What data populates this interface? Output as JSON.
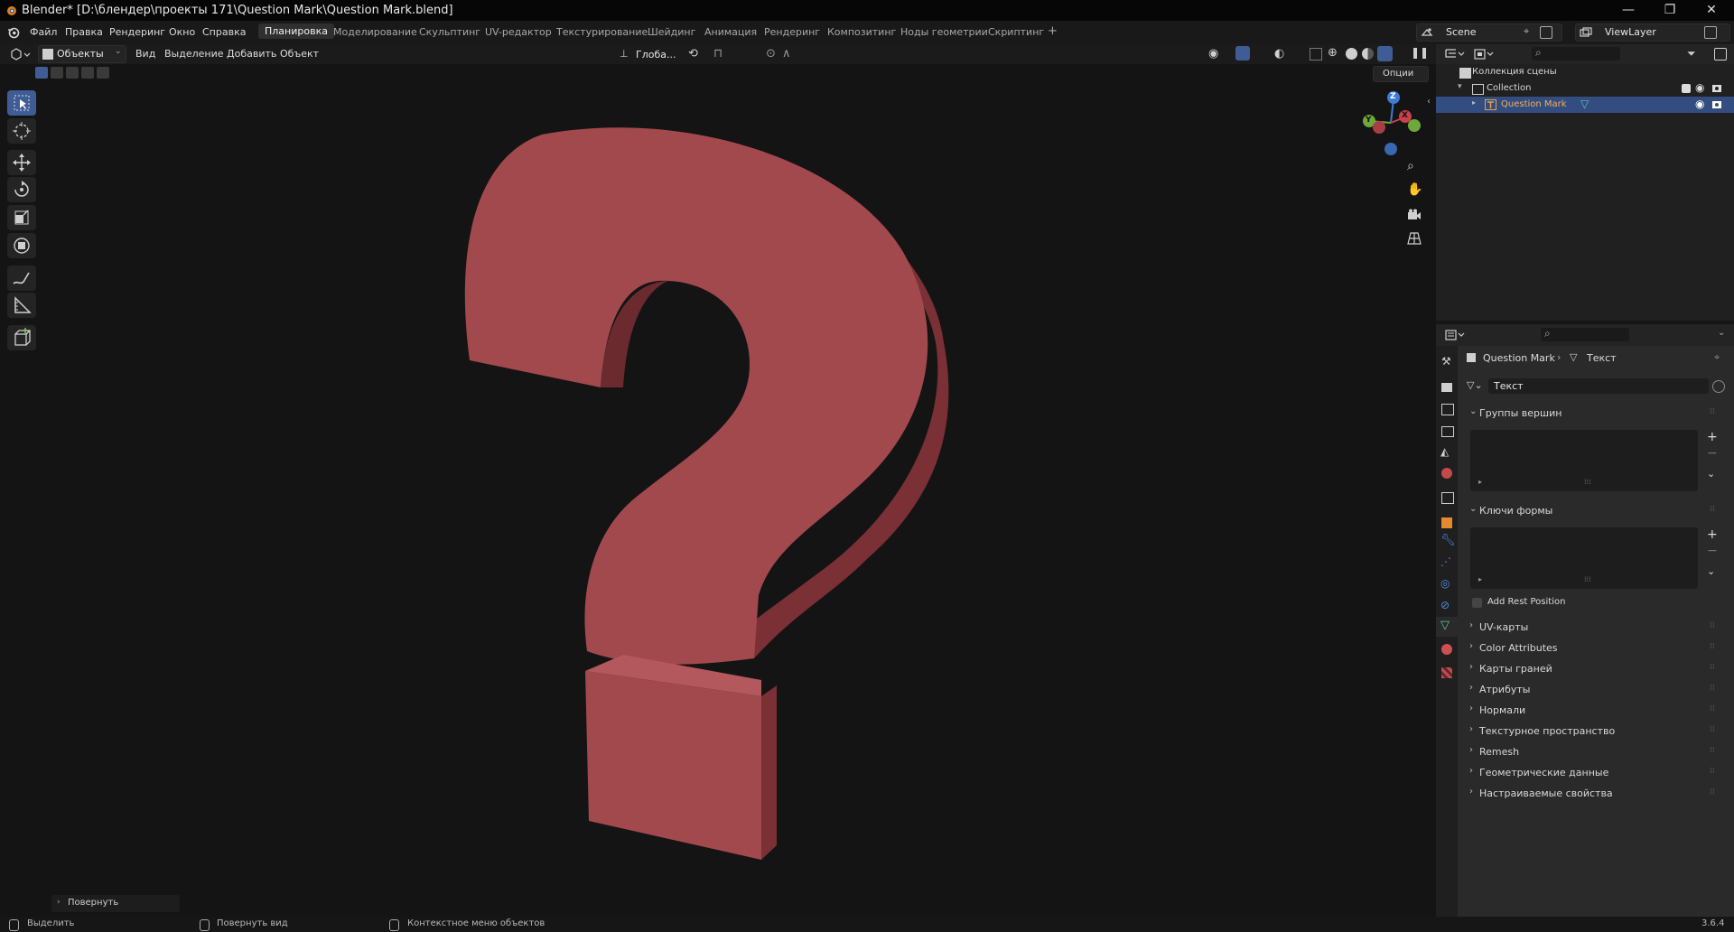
{
  "window": {
    "title": "Blender* [D:\\блендер\\проекты 171\\Question Mark\\Question Mark.blend]",
    "minimize": "—",
    "maximize": "❐",
    "close": "✕"
  },
  "menu": [
    "Файл",
    "Правка",
    "Рендеринг",
    "Окно",
    "Справка"
  ],
  "workspaces": [
    "Планировка",
    "Моделирование",
    "Скульптинг",
    "UV-редактор",
    "Текстурирование",
    "Шейдинг",
    "Анимация",
    "Рендеринг",
    "Композитинг",
    "Ноды геометрии",
    "Скриптинг"
  ],
  "active_workspace": "Планировка",
  "scene": {
    "label": "Scene",
    "view_layer": "ViewLayer"
  },
  "viewport": {
    "mode": "Объекты",
    "menus": [
      "Вид",
      "Выделение",
      "Добавить",
      "Объект"
    ],
    "orientation": "Глоба...",
    "options": "Опции",
    "gizmo": {
      "x": "X",
      "y": "Y",
      "z": "Z"
    },
    "operator_panel": "Повернуть",
    "accent": "#3f5d94",
    "object_color": "#a2494d"
  },
  "outliner": {
    "scene_collection": "Коллекция сцены",
    "collection": "Collection",
    "object": "Question Mark"
  },
  "properties": {
    "breadcrumb_object": "Question Mark",
    "breadcrumb_data": "Текст",
    "datablock_name": "Текст",
    "panels_open": [
      "Группы вершин",
      "Ключи формы"
    ],
    "add_rest_position": "Add Rest Position",
    "panels_closed": [
      "UV-карты",
      "Color Attributes",
      "Карты граней",
      "Атрибуты",
      "Нормали",
      "Текстурное пространство",
      "Remesh",
      "Геометрические данные",
      "Настраиваемые свойства"
    ]
  },
  "statusbar": {
    "select": "Выделить",
    "rotate_view": "Повернуть вид",
    "context_menu": "Контекстное меню объектов",
    "version": "3.6.4"
  }
}
